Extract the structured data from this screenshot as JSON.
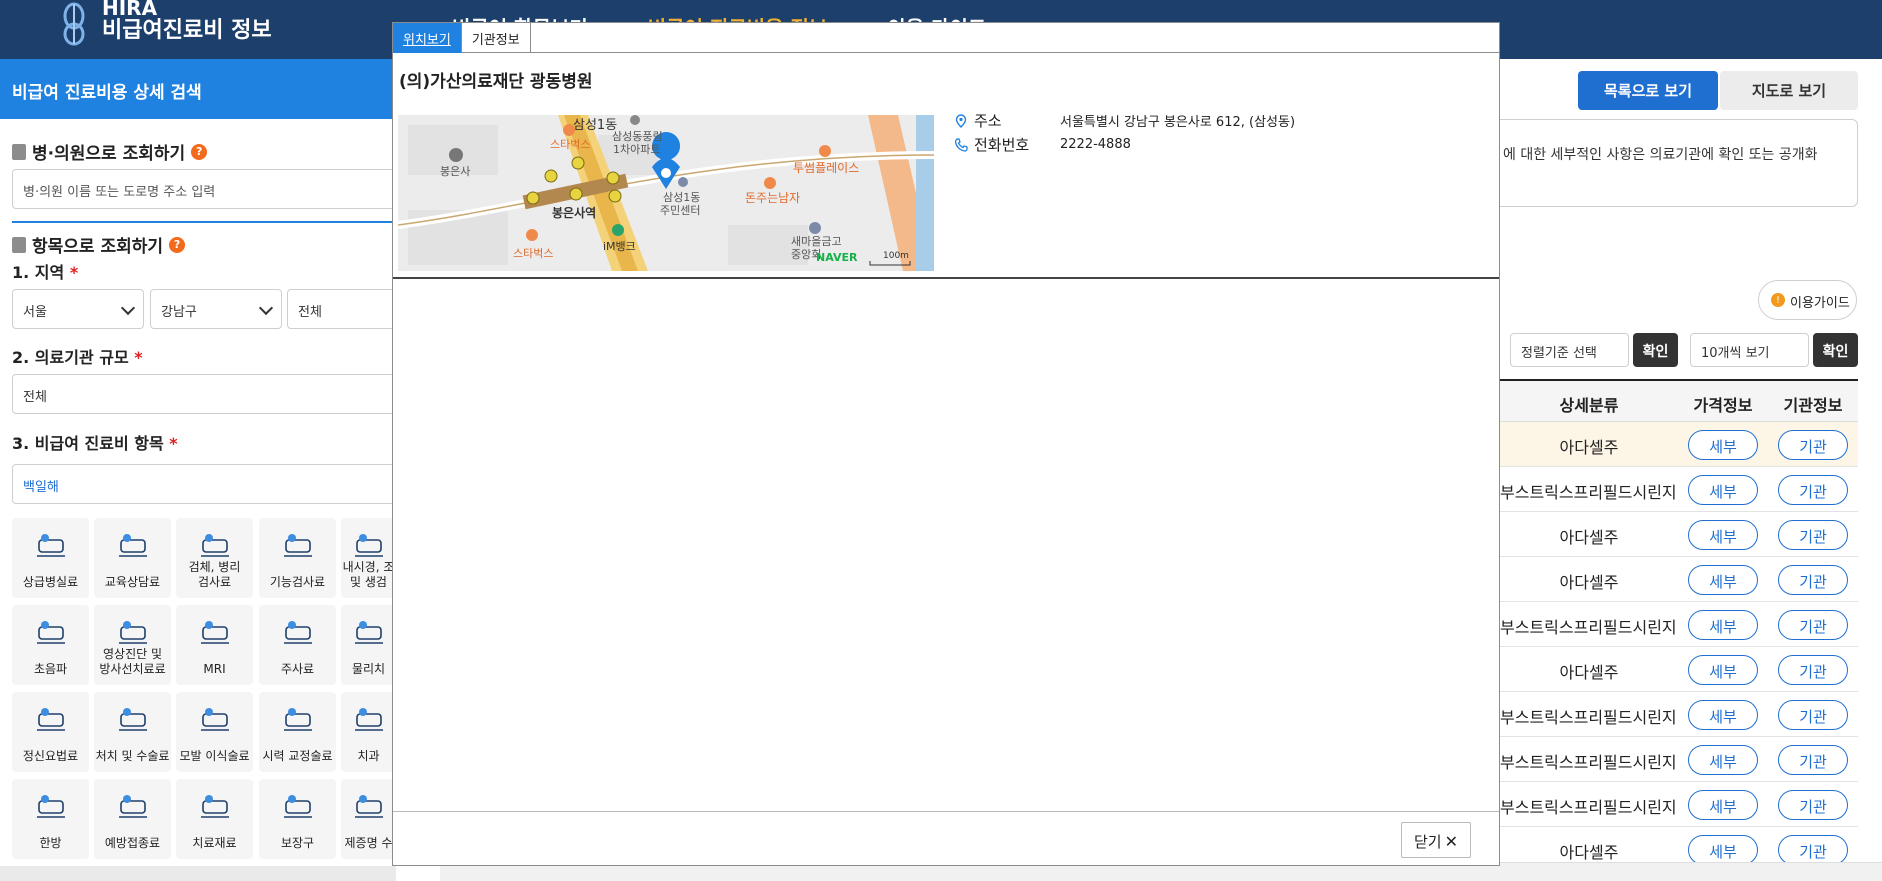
{
  "header": {
    "logo_en": "HIRA",
    "logo_ko": "비급여진료비 정보",
    "nav": [
      "비급여 항목보기",
      "비급여 진료비용 정보",
      "이용 가이드"
    ],
    "active_nav_color": "#f2b233"
  },
  "left": {
    "heading": "비급여 진료비용 상세 검색",
    "hospital_search_title": "병·의원으로 조회하기",
    "hospital_search_placeholder": "병·의원 이름 또는 도로명 주소 입력",
    "item_search_title": "항목으로 조회하기",
    "region_title": "1. 지역",
    "region_values": [
      "서울",
      "강남구",
      "전체"
    ],
    "scale_title": "2. 의료기관 규모",
    "scale_value": "전체",
    "item_title": "3. 비급여 진료비 항목",
    "item_value": "백일해",
    "required_mark": "*",
    "categories": [
      [
        "상급병실료",
        "교육상담료",
        "검체, 병리\n검사료",
        "기능검사료",
        "내시경, 조\n및 생검"
      ],
      [
        "초음파",
        "영상진단 및\n방사선치료료",
        "MRI",
        "주사료",
        "물리치"
      ],
      [
        "정신요법료",
        "처치 및 수술료",
        "모발 이식술료",
        "시력 교정술료",
        "치과"
      ],
      [
        "한방",
        "예방접종료",
        "치료재료",
        "보장구",
        "제증명 수"
      ]
    ]
  },
  "right": {
    "list_view": "목록으로 보기",
    "map_view": "지도로 보기",
    "notice": "에 대한 세부적인 사항은 의료기관에 확인 또는 공개화",
    "guide": "이용가이드",
    "sort_placeholder": "정렬기준 선택",
    "confirm": "확인",
    "per_page": "10개씩 보기",
    "table_headers": [
      "상세분류",
      "가격정보",
      "기관정보"
    ],
    "rows": [
      {
        "cat": "아다셀주",
        "detail": "세부",
        "org": "기관"
      },
      {
        "cat": "부스트릭스프리필드시린지",
        "detail": "세부",
        "org": "기관"
      },
      {
        "cat": "아다셀주",
        "detail": "세부",
        "org": "기관"
      },
      {
        "cat": "아다셀주",
        "detail": "세부",
        "org": "기관"
      },
      {
        "cat": "부스트릭스프리필드시린지",
        "detail": "세부",
        "org": "기관"
      },
      {
        "cat": "아다셀주",
        "detail": "세부",
        "org": "기관"
      },
      {
        "cat": "부스트릭스프리필드시린지",
        "detail": "세부",
        "org": "기관"
      },
      {
        "cat": "부스트릭스프리필드시린지",
        "detail": "세부",
        "org": "기관"
      },
      {
        "cat": "부스트릭스프리필드시린지",
        "detail": "세부",
        "org": "기관"
      },
      {
        "cat": "아다셀주",
        "detail": "세부",
        "org": "기관"
      }
    ]
  },
  "modal": {
    "tabs": [
      "위치보기",
      "기관정보"
    ],
    "title": "(의)가산의료재단 광동병원",
    "address_label": "주소",
    "address": "서울특별시 강남구 봉은사로 612, (삼성동)",
    "phone_label": "전화번호",
    "phone": "2222-4888",
    "close": "닫기",
    "map": {
      "labels": [
        "삼성1동",
        "스타벅스",
        "삼성동풍림\n1차아파트",
        "봉은사",
        "투썸플레이스",
        "봉은사역",
        "삼성1동\n주민센터",
        "돈주는남자",
        "스타벅스",
        "iM뱅크",
        "새마을금고\n중앙회",
        "NAVER",
        "100m"
      ]
    }
  }
}
